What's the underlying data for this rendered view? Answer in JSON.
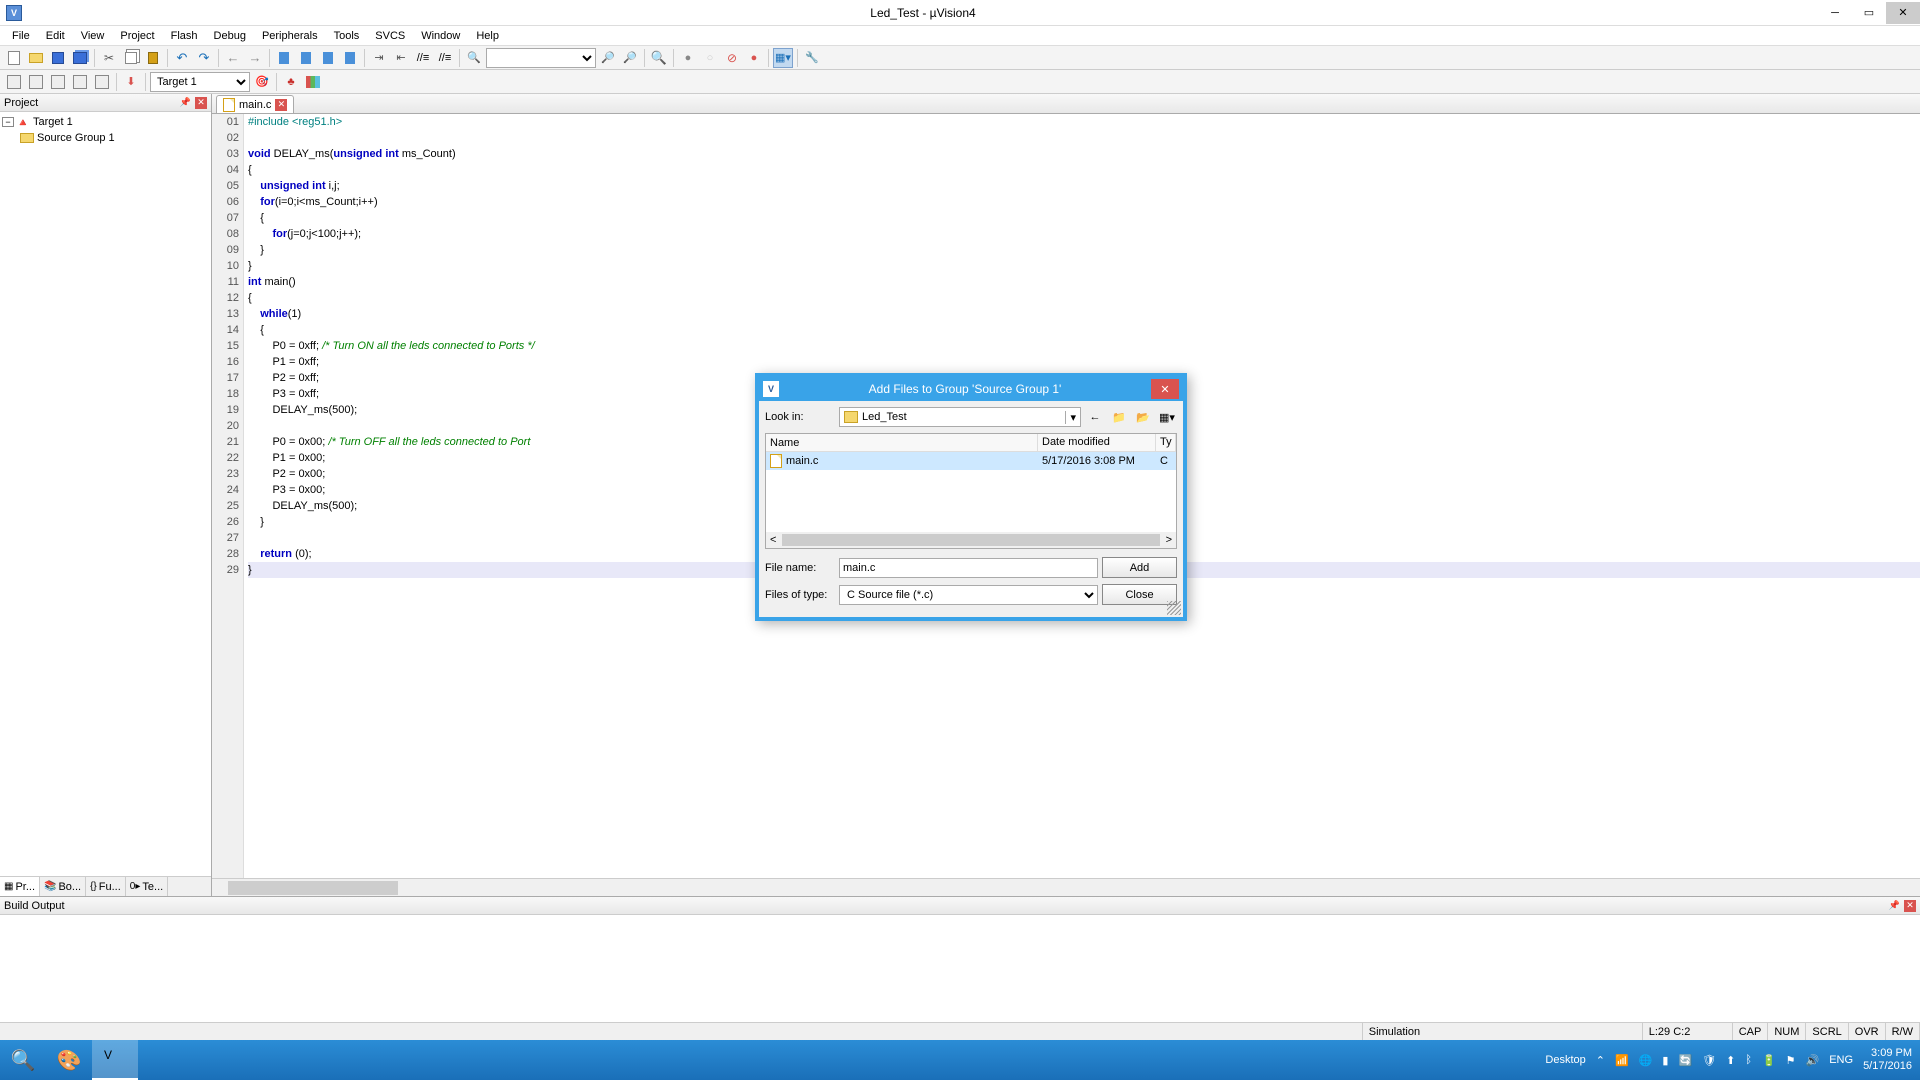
{
  "window": {
    "title": "Led_Test  - µVision4"
  },
  "menu": [
    "File",
    "Edit",
    "View",
    "Project",
    "Flash",
    "Debug",
    "Peripherals",
    "Tools",
    "SVCS",
    "Window",
    "Help"
  ],
  "toolbar2": {
    "target": "Target 1"
  },
  "project": {
    "title": "Project",
    "root": "Target 1",
    "group": "Source Group 1",
    "tabs": [
      "Pr...",
      "Bo...",
      "Fu...",
      "Te..."
    ]
  },
  "editor": {
    "tab": "main.c",
    "lines": [
      {
        "n": "01",
        "t": "#include <reg51.h>",
        "cls": "pp"
      },
      {
        "n": "02",
        "t": ""
      },
      {
        "n": "03",
        "html": "<span class='kw'>void</span> DELAY_ms(<span class='kw'>unsigned int</span> ms_Count)"
      },
      {
        "n": "04",
        "t": "{"
      },
      {
        "n": "05",
        "html": "    <span class='kw'>unsigned int</span> i,j;"
      },
      {
        "n": "06",
        "html": "    <span class='kw'>for</span>(i=0;i&lt;ms_Count;i++)"
      },
      {
        "n": "07",
        "t": "    {"
      },
      {
        "n": "08",
        "html": "        <span class='kw'>for</span>(j=0;j&lt;100;j++);"
      },
      {
        "n": "09",
        "t": "    }"
      },
      {
        "n": "10",
        "t": "}"
      },
      {
        "n": "11",
        "html": "<span class='kw'>int</span> main()"
      },
      {
        "n": "12",
        "t": "{"
      },
      {
        "n": "13",
        "html": "    <span class='kw'>while</span>(1)"
      },
      {
        "n": "14",
        "t": "    {"
      },
      {
        "n": "15",
        "html": "        P0 = 0xff; <span class='cm'>/* Turn ON all the leds connected to Ports */</span>"
      },
      {
        "n": "16",
        "t": "        P1 = 0xff;"
      },
      {
        "n": "17",
        "t": "        P2 = 0xff;"
      },
      {
        "n": "18",
        "t": "        P3 = 0xff;"
      },
      {
        "n": "19",
        "t": "        DELAY_ms(500);"
      },
      {
        "n": "20",
        "t": ""
      },
      {
        "n": "21",
        "html": "        P0 = 0x00; <span class='cm'>/* Turn OFF all the leds connected to Port</span>"
      },
      {
        "n": "22",
        "t": "        P1 = 0x00;"
      },
      {
        "n": "23",
        "t": "        P2 = 0x00;"
      },
      {
        "n": "24",
        "t": "        P3 = 0x00;"
      },
      {
        "n": "25",
        "t": "        DELAY_ms(500);"
      },
      {
        "n": "26",
        "t": "    }"
      },
      {
        "n": "27",
        "t": ""
      },
      {
        "n": "28",
        "html": "    <span class='kw'>return</span> (0);"
      },
      {
        "n": "29",
        "t": "}",
        "hl": true
      }
    ]
  },
  "build": {
    "title": "Build Output"
  },
  "status": {
    "mode": "Simulation",
    "pos": "L:29 C:2",
    "caps": "CAP",
    "num": "NUM",
    "scrl": "SCRL",
    "ovr": "OVR",
    "rw": "R/W"
  },
  "dialog": {
    "title": "Add Files to Group 'Source Group 1'",
    "look_in_label": "Look in:",
    "look_in": "Led_Test",
    "cols": {
      "name": "Name",
      "date": "Date modified",
      "type": "Ty"
    },
    "file": {
      "name": "main.c",
      "date": "5/17/2016 3:08 PM",
      "type": "C"
    },
    "filename_label": "File name:",
    "filename": "main.c",
    "filetype_label": "Files of type:",
    "filetype": "C Source file (*.c)",
    "add": "Add",
    "close": "Close"
  },
  "taskbar": {
    "desktop": "Desktop",
    "lang": "ENG",
    "time": "3:09 PM",
    "date": "5/17/2016"
  }
}
